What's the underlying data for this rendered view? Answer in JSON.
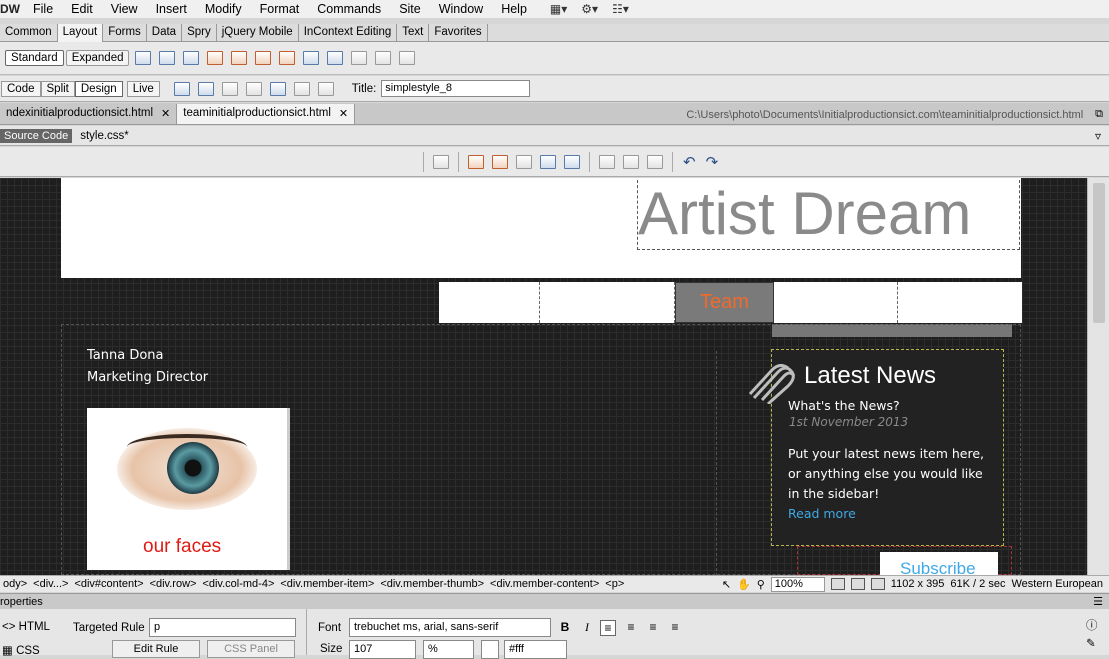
{
  "app": {
    "logo": "DW"
  },
  "menu": [
    "File",
    "Edit",
    "View",
    "Insert",
    "Modify",
    "Format",
    "Commands",
    "Site",
    "Window",
    "Help"
  ],
  "menu_icons": [
    "layout-icon",
    "gear-icon",
    "sitemap-icon"
  ],
  "insert_tabs": [
    "Common",
    "Layout",
    "Forms",
    "Data",
    "Spry",
    "jQuery Mobile",
    "InContext Editing",
    "Text",
    "Favorites"
  ],
  "insert_active": "Layout",
  "layout_toolbar": {
    "standard": "Standard",
    "expanded": "Expanded"
  },
  "doc_toolbar": {
    "code": "Code",
    "split": "Split",
    "design": "Design",
    "live": "Live",
    "title_label": "Title:",
    "title_value": "simplestyle_8"
  },
  "doc_tabs": [
    {
      "label": "ndexinitialproductionsict.html"
    },
    {
      "label": "teaminitialproductionsict.html"
    }
  ],
  "doc_path": "C:\\Users\\photo\\Documents\\Initialproductionsict.com\\teaminitialproductionsict.html",
  "related": {
    "source": "Source Code",
    "file": "style.css*"
  },
  "design": {
    "brand": "Artist Dream",
    "nav_active": "Team",
    "member_name": "Tanna Dona",
    "member_role": "Marketing Director",
    "thumb_caption": "our faces",
    "sidebar": {
      "title": "Latest News",
      "subtitle": "What's the News?",
      "date": "1st November 2013",
      "body": "Put your latest news item here, or anything else you would like in the sidebar!",
      "more": "Read more",
      "subscribe": "Subscribe"
    }
  },
  "tag_selector": [
    "ody>",
    "<div...>",
    "<div#content>",
    "<div.row>",
    "<div.col-md-4>",
    "<div.member-item>",
    "<div.member-thumb>",
    "<div.member-content>",
    "<p>"
  ],
  "status": {
    "zoom": "100%",
    "size": "1102 x 395",
    "weight": "61K / 2 sec",
    "encoding": "Western European"
  },
  "properties": {
    "header": "roperties",
    "html_tab": "HTML",
    "css_tab": "CSS",
    "targeted_rule_label": "Targeted Rule",
    "targeted_rule_value": "p",
    "edit_rule": "Edit Rule",
    "css_panel": "CSS Panel",
    "font_label": "Font",
    "font_value": "trebuchet ms, arial, sans-serif",
    "size_label": "Size",
    "size_value": "107",
    "size_unit": "%",
    "color_value": "#fff",
    "bold": "B",
    "italic": "I"
  }
}
